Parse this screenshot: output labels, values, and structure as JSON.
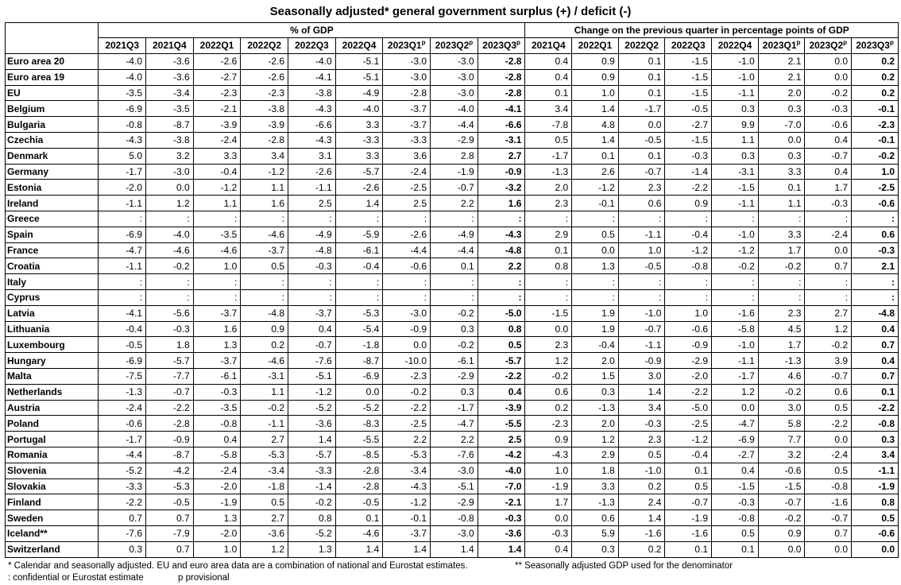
{
  "title": "Seasonally adjusted* general government surplus (+) / deficit (-)",
  "groups": {
    "pct": "% of GDP",
    "change": "Change on the previous quarter in percentage points of GDP"
  },
  "pct_columns": [
    {
      "label": "2021Q3",
      "sup": ""
    },
    {
      "label": "2021Q4",
      "sup": ""
    },
    {
      "label": "2022Q1",
      "sup": ""
    },
    {
      "label": "2022Q2",
      "sup": ""
    },
    {
      "label": "2022Q3",
      "sup": ""
    },
    {
      "label": "2022Q4",
      "sup": ""
    },
    {
      "label": "2023Q1",
      "sup": "p"
    },
    {
      "label": "2023Q2",
      "sup": "p"
    },
    {
      "label": "2023Q3",
      "sup": "p"
    }
  ],
  "change_columns": [
    {
      "label": "2021Q4",
      "sup": ""
    },
    {
      "label": "2022Q1",
      "sup": ""
    },
    {
      "label": "2022Q2",
      "sup": ""
    },
    {
      "label": "2022Q3",
      "sup": ""
    },
    {
      "label": "2022Q4",
      "sup": ""
    },
    {
      "label": "2023Q1",
      "sup": "p"
    },
    {
      "label": "2023Q2",
      "sup": "p"
    },
    {
      "label": "2023Q3",
      "sup": "p"
    }
  ],
  "rows": [
    {
      "name": "Euro area 20",
      "pct": [
        "-4.0",
        "-3.6",
        "-2.6",
        "-2.6",
        "-4.0",
        "-5.1",
        "-3.0",
        "-3.0",
        "-2.8"
      ],
      "change": [
        "0.4",
        "0.9",
        "0.1",
        "-1.5",
        "-1.0",
        "2.1",
        "0.0",
        "0.2"
      ]
    },
    {
      "name": "Euro area 19",
      "pct": [
        "-4.0",
        "-3.6",
        "-2.7",
        "-2.6",
        "-4.1",
        "-5.1",
        "-3.0",
        "-3.0",
        "-2.8"
      ],
      "change": [
        "0.4",
        "0.9",
        "0.1",
        "-1.5",
        "-1.0",
        "2.1",
        "0.0",
        "0.2"
      ]
    },
    {
      "name": "EU",
      "pct": [
        "-3.5",
        "-3.4",
        "-2.3",
        "-2.3",
        "-3.8",
        "-4.9",
        "-2.8",
        "-3.0",
        "-2.8"
      ],
      "change": [
        "0.1",
        "1.0",
        "0.1",
        "-1.5",
        "-1.1",
        "2.0",
        "-0.2",
        "0.2"
      ]
    },
    {
      "name": "Belgium",
      "pct": [
        "-6.9",
        "-3.5",
        "-2.1",
        "-3.8",
        "-4.3",
        "-4.0",
        "-3.7",
        "-4.0",
        "-4.1"
      ],
      "change": [
        "3.4",
        "1.4",
        "-1.7",
        "-0.5",
        "0.3",
        "0.3",
        "-0.3",
        "-0.1"
      ]
    },
    {
      "name": "Bulgaria",
      "pct": [
        "-0.8",
        "-8.7",
        "-3.9",
        "-3.9",
        "-6.6",
        "3.3",
        "-3.7",
        "-4.4",
        "-6.6"
      ],
      "change": [
        "-7.8",
        "4.8",
        "0.0",
        "-2.7",
        "9.9",
        "-7.0",
        "-0.6",
        "-2.3"
      ]
    },
    {
      "name": "Czechia",
      "pct": [
        "-4.3",
        "-3.8",
        "-2.4",
        "-2.8",
        "-4.3",
        "-3.3",
        "-3.3",
        "-2.9",
        "-3.1"
      ],
      "change": [
        "0.5",
        "1.4",
        "-0.5",
        "-1.5",
        "1.1",
        "0.0",
        "0.4",
        "-0.1"
      ]
    },
    {
      "name": "Denmark",
      "pct": [
        "5.0",
        "3.2",
        "3.3",
        "3.4",
        "3.1",
        "3.3",
        "3.6",
        "2.8",
        "2.7"
      ],
      "change": [
        "-1.7",
        "0.1",
        "0.1",
        "-0.3",
        "0.3",
        "0.3",
        "-0.7",
        "-0.2"
      ]
    },
    {
      "name": "Germany",
      "pct": [
        "-1.7",
        "-3.0",
        "-0.4",
        "-1.2",
        "-2.6",
        "-5.7",
        "-2.4",
        "-1.9",
        "-0.9"
      ],
      "change": [
        "-1.3",
        "2.6",
        "-0.7",
        "-1.4",
        "-3.1",
        "3.3",
        "0.4",
        "1.0"
      ]
    },
    {
      "name": "Estonia",
      "pct": [
        "-2.0",
        "0.0",
        "-1.2",
        "1.1",
        "-1.1",
        "-2.6",
        "-2.5",
        "-0.7",
        "-3.2"
      ],
      "change": [
        "2.0",
        "-1.2",
        "2.3",
        "-2.2",
        "-1.5",
        "0.1",
        "1.7",
        "-2.5"
      ]
    },
    {
      "name": "Ireland",
      "pct": [
        "-1.1",
        "1.2",
        "1.1",
        "1.6",
        "2.5",
        "1.4",
        "2.5",
        "2.2",
        "1.6"
      ],
      "change": [
        "2.3",
        "-0.1",
        "0.6",
        "0.9",
        "-1.1",
        "1.1",
        "-0.3",
        "-0.6"
      ]
    },
    {
      "name": "Greece",
      "pct": [
        ":",
        ":",
        ":",
        ":",
        ":",
        ":",
        ":",
        ":",
        ":"
      ],
      "change": [
        ":",
        ":",
        ":",
        ":",
        ":",
        ":",
        ":",
        ":"
      ]
    },
    {
      "name": "Spain",
      "pct": [
        "-6.9",
        "-4.0",
        "-3.5",
        "-4.6",
        "-4.9",
        "-5.9",
        "-2.6",
        "-4.9",
        "-4.3"
      ],
      "change": [
        "2.9",
        "0.5",
        "-1.1",
        "-0.4",
        "-1.0",
        "3.3",
        "-2.4",
        "0.6"
      ]
    },
    {
      "name": "France",
      "pct": [
        "-4.7",
        "-4.6",
        "-4.6",
        "-3.7",
        "-4.8",
        "-6.1",
        "-4.4",
        "-4.4",
        "-4.8"
      ],
      "change": [
        "0.1",
        "0.0",
        "1.0",
        "-1.2",
        "-1.2",
        "1.7",
        "0.0",
        "-0.3"
      ]
    },
    {
      "name": "Croatia",
      "pct": [
        "-1.1",
        "-0.2",
        "1.0",
        "0.5",
        "-0.3",
        "-0.4",
        "-0.6",
        "0.1",
        "2.2"
      ],
      "change": [
        "0.8",
        "1.3",
        "-0.5",
        "-0.8",
        "-0.2",
        "-0.2",
        "0.7",
        "2.1"
      ]
    },
    {
      "name": "Italy",
      "pct": [
        ":",
        ":",
        ":",
        ":",
        ":",
        ":",
        ":",
        ":",
        ":"
      ],
      "change": [
        ":",
        ":",
        ":",
        ":",
        ":",
        ":",
        ":",
        ":"
      ]
    },
    {
      "name": "Cyprus",
      "pct": [
        ":",
        ":",
        ":",
        ":",
        ":",
        ":",
        ":",
        ":",
        ":"
      ],
      "change": [
        ":",
        ":",
        ":",
        ":",
        ":",
        ":",
        ":",
        ":"
      ]
    },
    {
      "name": "Latvia",
      "pct": [
        "-4.1",
        "-5.6",
        "-3.7",
        "-4.8",
        "-3.7",
        "-5.3",
        "-3.0",
        "-0.2",
        "-5.0"
      ],
      "change": [
        "-1.5",
        "1.9",
        "-1.0",
        "1.0",
        "-1.6",
        "2.3",
        "2.7",
        "-4.8"
      ]
    },
    {
      "name": "Lithuania",
      "pct": [
        "-0.4",
        "-0.3",
        "1.6",
        "0.9",
        "0.4",
        "-5.4",
        "-0.9",
        "0.3",
        "0.8"
      ],
      "change": [
        "0.0",
        "1.9",
        "-0.7",
        "-0.6",
        "-5.8",
        "4.5",
        "1.2",
        "0.4"
      ]
    },
    {
      "name": "Luxembourg",
      "pct": [
        "-0.5",
        "1.8",
        "1.3",
        "0.2",
        "-0.7",
        "-1.8",
        "0.0",
        "-0.2",
        "0.5"
      ],
      "change": [
        "2.3",
        "-0.4",
        "-1.1",
        "-0.9",
        "-1.0",
        "1.7",
        "-0.2",
        "0.7"
      ]
    },
    {
      "name": "Hungary",
      "pct": [
        "-6.9",
        "-5.7",
        "-3.7",
        "-4.6",
        "-7.6",
        "-8.7",
        "-10.0",
        "-6.1",
        "-5.7"
      ],
      "change": [
        "1.2",
        "2.0",
        "-0.9",
        "-2.9",
        "-1.1",
        "-1.3",
        "3.9",
        "0.4"
      ]
    },
    {
      "name": "Malta",
      "pct": [
        "-7.5",
        "-7.7",
        "-6.1",
        "-3.1",
        "-5.1",
        "-6.9",
        "-2.3",
        "-2.9",
        "-2.2"
      ],
      "change": [
        "-0.2",
        "1.5",
        "3.0",
        "-2.0",
        "-1.7",
        "4.6",
        "-0.7",
        "0.7"
      ]
    },
    {
      "name": "Netherlands",
      "pct": [
        "-1.3",
        "-0.7",
        "-0.3",
        "1.1",
        "-1.2",
        "0.0",
        "-0.2",
        "0.3",
        "0.4"
      ],
      "change": [
        "0.6",
        "0.3",
        "1.4",
        "-2.2",
        "1.2",
        "-0.2",
        "0.6",
        "0.1"
      ]
    },
    {
      "name": "Austria",
      "pct": [
        "-2.4",
        "-2.2",
        "-3.5",
        "-0.2",
        "-5.2",
        "-5.2",
        "-2.2",
        "-1.7",
        "-3.9"
      ],
      "change": [
        "0.2",
        "-1.3",
        "3.4",
        "-5.0",
        "0.0",
        "3.0",
        "0.5",
        "-2.2"
      ]
    },
    {
      "name": "Poland",
      "pct": [
        "-0.6",
        "-2.8",
        "-0.8",
        "-1.1",
        "-3.6",
        "-8.3",
        "-2.5",
        "-4.7",
        "-5.5"
      ],
      "change": [
        "-2.3",
        "2.0",
        "-0.3",
        "-2.5",
        "-4.7",
        "5.8",
        "-2.2",
        "-0.8"
      ]
    },
    {
      "name": "Portugal",
      "pct": [
        "-1.7",
        "-0.9",
        "0.4",
        "2.7",
        "1.4",
        "-5.5",
        "2.2",
        "2.2",
        "2.5"
      ],
      "change": [
        "0.9",
        "1.2",
        "2.3",
        "-1.2",
        "-6.9",
        "7.7",
        "0.0",
        "0.3"
      ]
    },
    {
      "name": "Romania",
      "pct": [
        "-4.4",
        "-8.7",
        "-5.8",
        "-5.3",
        "-5.7",
        "-8.5",
        "-5.3",
        "-7.6",
        "-4.2"
      ],
      "change": [
        "-4.3",
        "2.9",
        "0.5",
        "-0.4",
        "-2.7",
        "3.2",
        "-2.4",
        "3.4"
      ]
    },
    {
      "name": "Slovenia",
      "pct": [
        "-5.2",
        "-4.2",
        "-2.4",
        "-3.4",
        "-3.3",
        "-2.8",
        "-3.4",
        "-3.0",
        "-4.0"
      ],
      "change": [
        "1.0",
        "1.8",
        "-1.0",
        "0.1",
        "0.4",
        "-0.6",
        "0.5",
        "-1.1"
      ]
    },
    {
      "name": "Slovakia",
      "pct": [
        "-3.3",
        "-5.3",
        "-2.0",
        "-1.8",
        "-1.4",
        "-2.8",
        "-4.3",
        "-5.1",
        "-7.0"
      ],
      "change": [
        "-1.9",
        "3.3",
        "0.2",
        "0.5",
        "-1.5",
        "-1.5",
        "-0.8",
        "-1.9"
      ]
    },
    {
      "name": "Finland",
      "pct": [
        "-2.2",
        "-0.5",
        "-1.9",
        "0.5",
        "-0.2",
        "-0.5",
        "-1.2",
        "-2.9",
        "-2.1"
      ],
      "change": [
        "1.7",
        "-1.3",
        "2.4",
        "-0.7",
        "-0.3",
        "-0.7",
        "-1.6",
        "0.8"
      ]
    },
    {
      "name": "Sweden",
      "pct": [
        "0.7",
        "0.7",
        "1.3",
        "2.7",
        "0.8",
        "0.1",
        "-0.1",
        "-0.8",
        "-0.3"
      ],
      "change": [
        "0.0",
        "0.6",
        "1.4",
        "-1.9",
        "-0.8",
        "-0.2",
        "-0.7",
        "0.5"
      ]
    },
    {
      "name": "Iceland**",
      "pct": [
        "-7.6",
        "-7.9",
        "-2.0",
        "-3.6",
        "-5.2",
        "-4.6",
        "-3.7",
        "-3.0",
        "-3.6"
      ],
      "change": [
        "-0.3",
        "5.9",
        "-1.6",
        "-1.6",
        "0.5",
        "0.9",
        "0.7",
        "-0.6"
      ]
    },
    {
      "name": "Switzerland",
      "pct": [
        "0.3",
        "0.7",
        "1.0",
        "1.2",
        "1.3",
        "1.4",
        "1.4",
        "1.4",
        "1.4"
      ],
      "change": [
        "0.4",
        "0.3",
        "0.2",
        "0.1",
        "0.1",
        "0.0",
        "0.0",
        "0.0"
      ]
    }
  ],
  "footnotes": {
    "star": "*   Calendar and seasonally adjusted. EU and euro area data are a combination of national and Eurostat estimates.",
    "double_star": "** Seasonally adjusted GDP used for the denominator",
    "colon": ":    confidential or Eurostat estimate",
    "p": "p provisional"
  }
}
